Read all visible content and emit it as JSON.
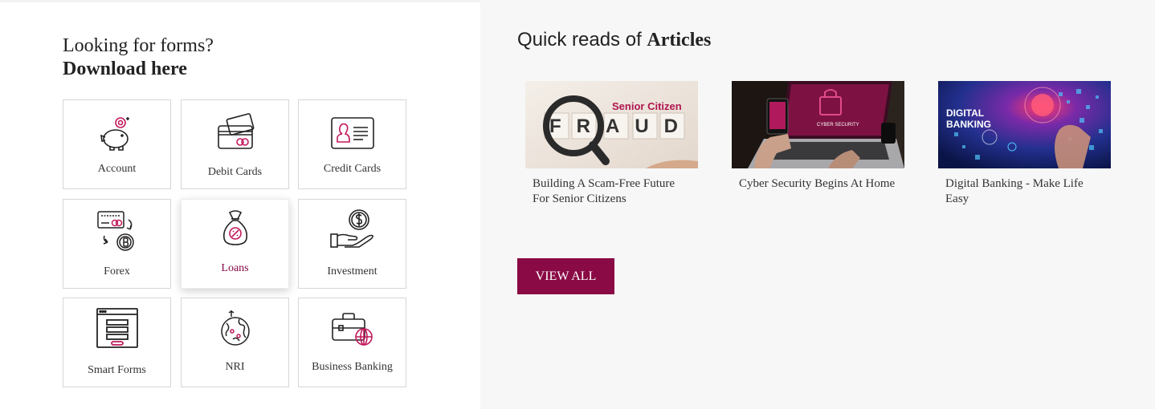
{
  "forms": {
    "heading_line1": "Looking for forms?",
    "heading_line2": "Download here",
    "tiles": [
      {
        "label": "Account",
        "icon": "piggy-bank-icon"
      },
      {
        "label": "Debit Cards",
        "icon": "debit-card-icon"
      },
      {
        "label": "Credit Cards",
        "icon": "credit-card-id-icon"
      },
      {
        "label": "Forex",
        "icon": "forex-exchange-icon"
      },
      {
        "label": "Loans",
        "icon": "money-bag-icon"
      },
      {
        "label": "Investment",
        "icon": "hand-coin-icon"
      },
      {
        "label": "Smart Forms",
        "icon": "form-document-icon"
      },
      {
        "label": "NRI",
        "icon": "globe-icon"
      },
      {
        "label": "Business Banking",
        "icon": "briefcase-globe-icon"
      }
    ],
    "active_tile": "Loans"
  },
  "articles": {
    "heading_prefix": "Quick reads of ",
    "heading_bold": "Articles",
    "items": [
      {
        "title": "Building A Scam-Free Future For Senior Citizens",
        "image_text_1": "Senior Citizen",
        "image_text_2": "FRAUD"
      },
      {
        "title": "Cyber Security Begins At Home",
        "image_text_1": "CYBER SECURITY"
      },
      {
        "title": "Digital Banking - Make Life Easy",
        "image_text_1": "DIGITAL",
        "image_text_2": "BANKING"
      }
    ],
    "view_all_label": "VIEW ALL"
  },
  "colors": {
    "brand": "#8a0a45",
    "accent_pink": "#c2185b",
    "right_panel_bg": "#f7f7f7"
  }
}
